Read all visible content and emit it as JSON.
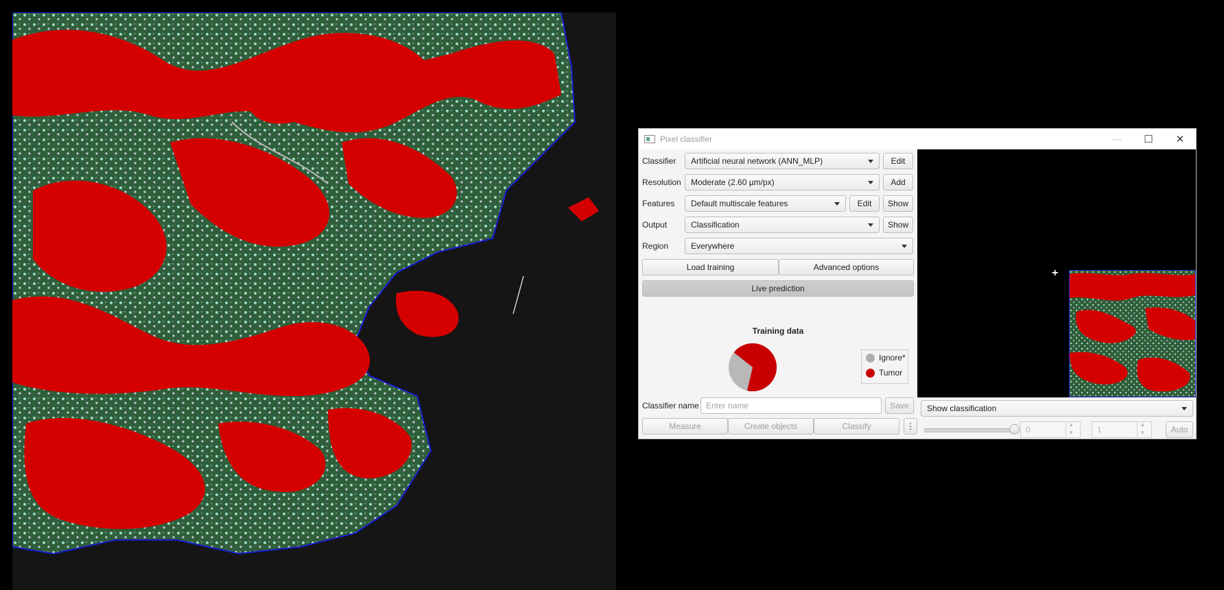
{
  "dialog": {
    "title": "Pixel classifier",
    "window_controls": [
      "minimize-icon",
      "maximize-icon",
      "close-icon"
    ]
  },
  "form": {
    "classifier": {
      "label": "Classifier",
      "value": "Artificial neural network (ANN_MLP)",
      "edit": "Edit"
    },
    "resolution": {
      "label": "Resolution",
      "value": "Moderate (2.60 µm/px)",
      "add": "Add"
    },
    "features": {
      "label": "Features",
      "value": "Default multiscale features",
      "edit": "Edit",
      "show": "Show"
    },
    "output": {
      "label": "Output",
      "value": "Classification",
      "show": "Show"
    },
    "region": {
      "label": "Region",
      "value": "Everywhere"
    },
    "load_training": "Load training",
    "advanced_options": "Advanced options",
    "live_prediction": "Live prediction"
  },
  "training": {
    "title": "Training data",
    "legend": [
      {
        "name": "Ignore*",
        "color": "#b0b0b0"
      },
      {
        "name": "Tumor",
        "color": "#c80000"
      }
    ],
    "fractions": {
      "Tumor": 0.68,
      "Ignore*": 0.32
    }
  },
  "classifier_name": {
    "label": "Classifier name",
    "placeholder": "Enter name",
    "save": "Save"
  },
  "actions": {
    "measure": "Measure",
    "create_objects": "Create objects",
    "classify": "Classify",
    "more": "⋮"
  },
  "preview": {
    "mode": "Show classification",
    "min_value": "0",
    "max_value": "1",
    "auto": "Auto",
    "slider_fraction": 1.0
  },
  "colors": {
    "overlay_red": "#d40000",
    "tissue_green": "#2f6b3a",
    "background": "#151515",
    "boundary_blue": "#1a1ad0"
  }
}
